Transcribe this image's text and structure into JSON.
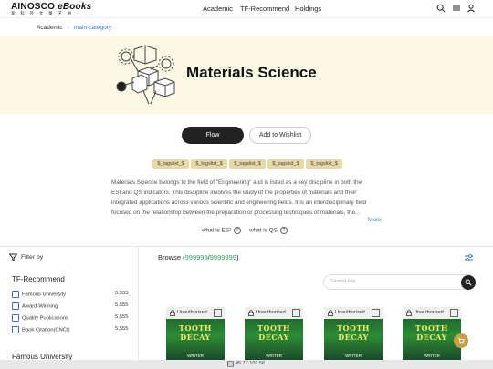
{
  "brand": {
    "name": "AINOSCO",
    "suffix": "eBooks",
    "subtitle": "爱 科 外 文 童 子 书"
  },
  "nav": {
    "items": [
      "Academic",
      "TF-Recommend",
      "Holdings"
    ]
  },
  "header_icons": [
    "search-icon",
    "menu-icon",
    "user-icon"
  ],
  "breadcrumb": {
    "root": "Academic",
    "separator": "-",
    "current": "main-category"
  },
  "hero": {
    "title": "Materials Science"
  },
  "actions": {
    "flow": "Flow",
    "wishlist": "Add to Wishlist"
  },
  "tags": [
    "$_tagslist_$",
    "$_tagslist_$",
    "$_tagslist_$",
    "$_tagslist_$",
    "$_tagslist_$"
  ],
  "description": {
    "lines": [
      "Materials Science belongs to the field of \"Engineering\" and is listed as a key discipline in both the",
      "ESI and QS indicators. This discipline involves the study of the properties of materials and their",
      "integrated applications across various scientific and engineering fields. It is an interdisciplinary field",
      "focused on the relationship between the preparation or processing techniques of materials, the..."
    ],
    "more": "More",
    "links": [
      "what is ESI",
      "what is QS"
    ],
    "help": "?"
  },
  "filter": {
    "label": "Filter by",
    "section": "TF-Recommend",
    "items": [
      {
        "label": "Famous University",
        "count": "5,555"
      },
      {
        "label": "Award-Winning",
        "count": "5,555"
      },
      {
        "label": "Quality Publications",
        "count": "5,555"
      },
      {
        "label": "Book Citation(CNCI)",
        "count": "5,555"
      }
    ],
    "next_section": "Famous University"
  },
  "browse": {
    "label": "Browse",
    "open": "(",
    "count_a": "999999",
    "slash": "/",
    "count_b": "9999999",
    "close": ")"
  },
  "search": {
    "placeholder": "Search title"
  },
  "cards": [
    {
      "status": "Unauthorized",
      "title": "TOOTH DECAY",
      "subtitle": "WRITER"
    },
    {
      "status": "Unauthorized",
      "title": "TOOTH DECAY",
      "subtitle": "WRITER"
    },
    {
      "status": "Unauthorized",
      "title": "TOOTH DECAY",
      "subtitle": "WRITER"
    },
    {
      "status": "Unauthorized",
      "title": "TOOTH DECAY",
      "subtitle": "WRITER"
    }
  ],
  "footer": {
    "ip": "45.77.102.56"
  },
  "colors": {
    "hero_bg": "#fcf8e6",
    "tag_bg": "#e8d8a8",
    "accent_green": "#2aa158",
    "link_blue": "#3d7bd9",
    "fab": "#c8a044"
  }
}
